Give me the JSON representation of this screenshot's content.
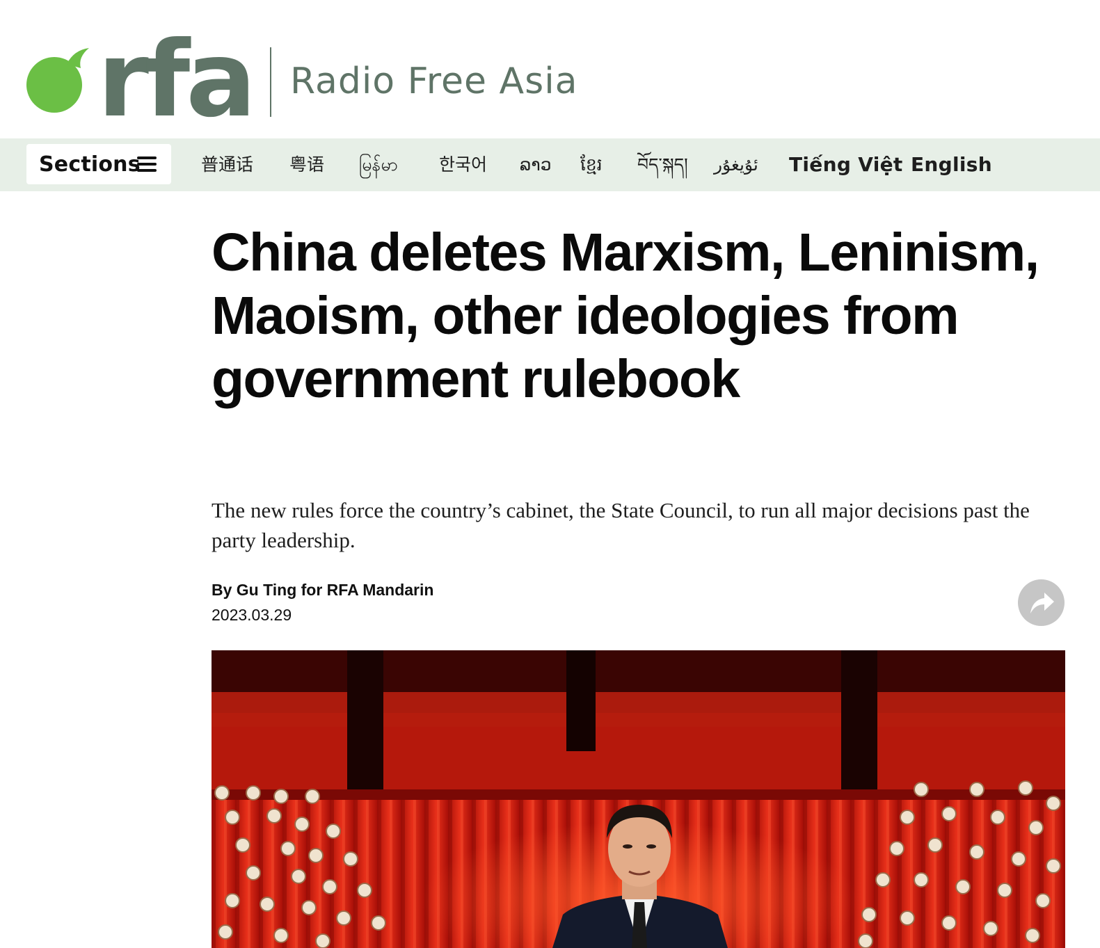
{
  "header": {
    "logo_text": "rfa",
    "brand_name": "Radio Free Asia"
  },
  "nav": {
    "sections_label": "Sections",
    "languages": [
      {
        "label": "普通话"
      },
      {
        "label": "粤语"
      },
      {
        "label": "မြန်မာ"
      },
      {
        "label": "한국어"
      },
      {
        "label": "ລາວ"
      },
      {
        "label": "ខ្មែរ"
      },
      {
        "label": "བོད་སྐད།"
      },
      {
        "label": "ئۇيغۇر"
      },
      {
        "label": "Tiếng Việt"
      },
      {
        "label": "English"
      }
    ]
  },
  "article": {
    "headline": "China deletes Marxism, Leninism, Maoism, other ideologies from government rulebook",
    "deck": "The new rules force the country’s cabinet, the State Council, to run all major decisions past the party leadership.",
    "byline": "By Gu Ting for RFA Mandarin",
    "date": "2023.03.29"
  },
  "colors": {
    "brand_green": "#6bbf45",
    "brand_gray": "#5f7467",
    "nav_background": "#e7efe7",
    "share_button": "#c6c6c6",
    "stage_red": "#c8140c"
  },
  "icons": {
    "menu": "hamburger-icon",
    "share": "share-arrow-icon"
  }
}
